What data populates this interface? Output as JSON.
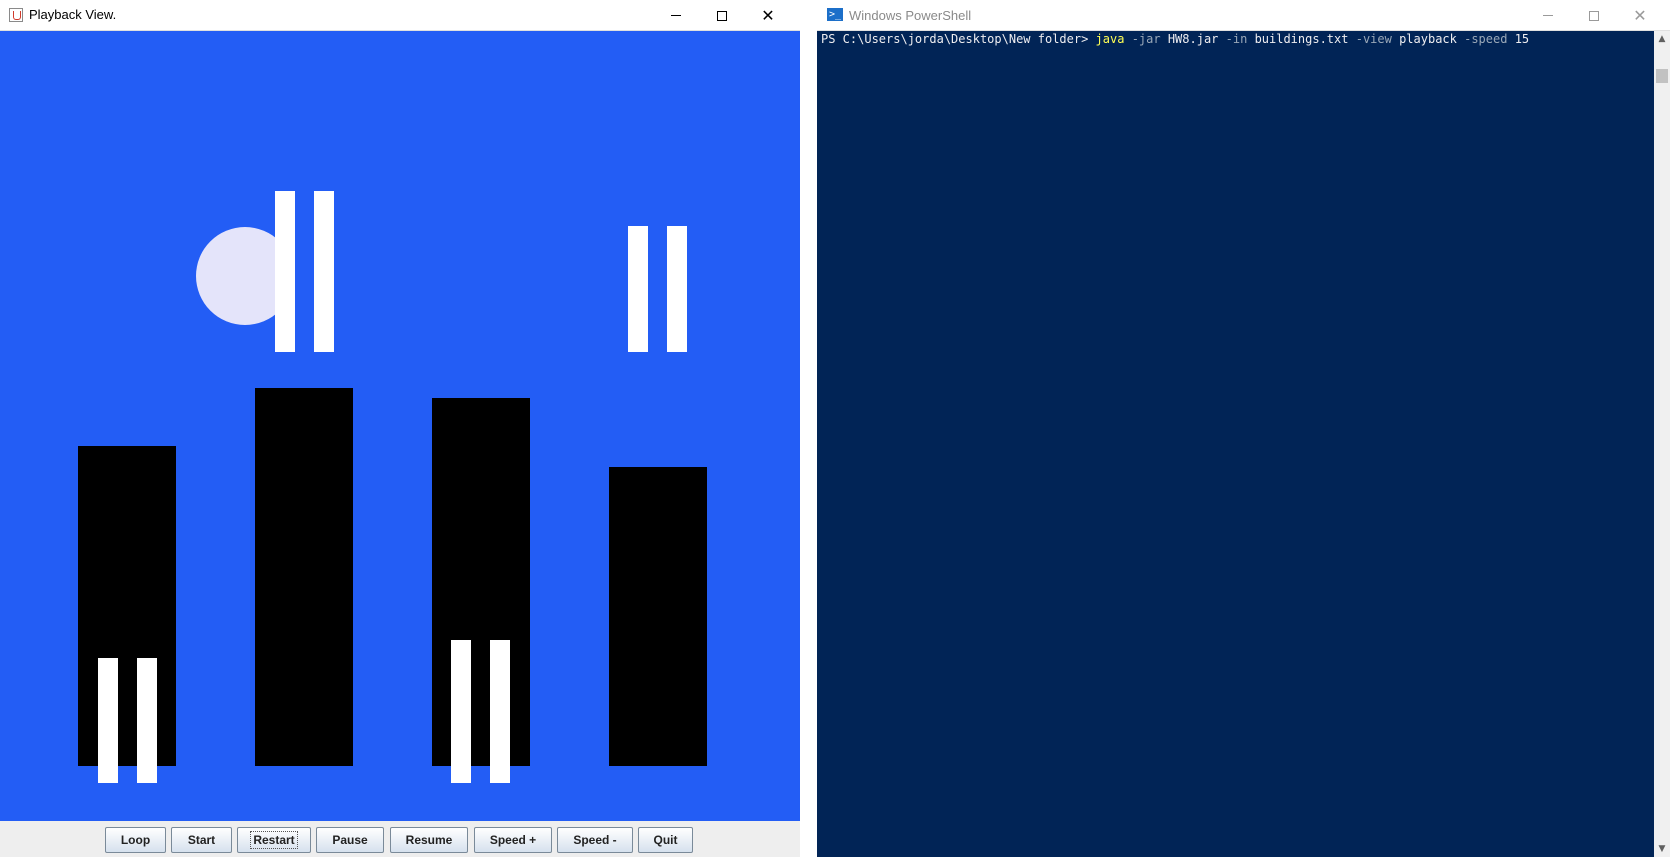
{
  "java_window": {
    "title": "Playback View.",
    "controls": {
      "minimize": "",
      "maximize": "",
      "close": "✕"
    },
    "canvas": {
      "background": "#235df5",
      "moon_color": "#e4e4fa",
      "building_color": "#000000",
      "window_color": "#ffffff"
    },
    "buttons": [
      "Loop",
      "Start",
      "Restart",
      "Pause",
      "Resume",
      "Speed +",
      "Speed -",
      "Quit"
    ],
    "focused_button": "Restart"
  },
  "powershell_window": {
    "title": "Windows PowerShell",
    "controls": {
      "minimize": "",
      "maximize": "",
      "close": "✕"
    },
    "prompt": "PS C:\\Users\\jorda\\Desktop\\New folder> ",
    "command": {
      "cmd": "java",
      "p1": "-jar",
      "v1": "HW8.jar",
      "p2": "-in",
      "v2": "buildings.txt",
      "p3": "-view",
      "v3": "playback",
      "p4": "-speed",
      "v4": "15"
    },
    "background": "#012456",
    "scrollbar": {
      "up_icon": "▲",
      "down_icon": "▼"
    }
  }
}
